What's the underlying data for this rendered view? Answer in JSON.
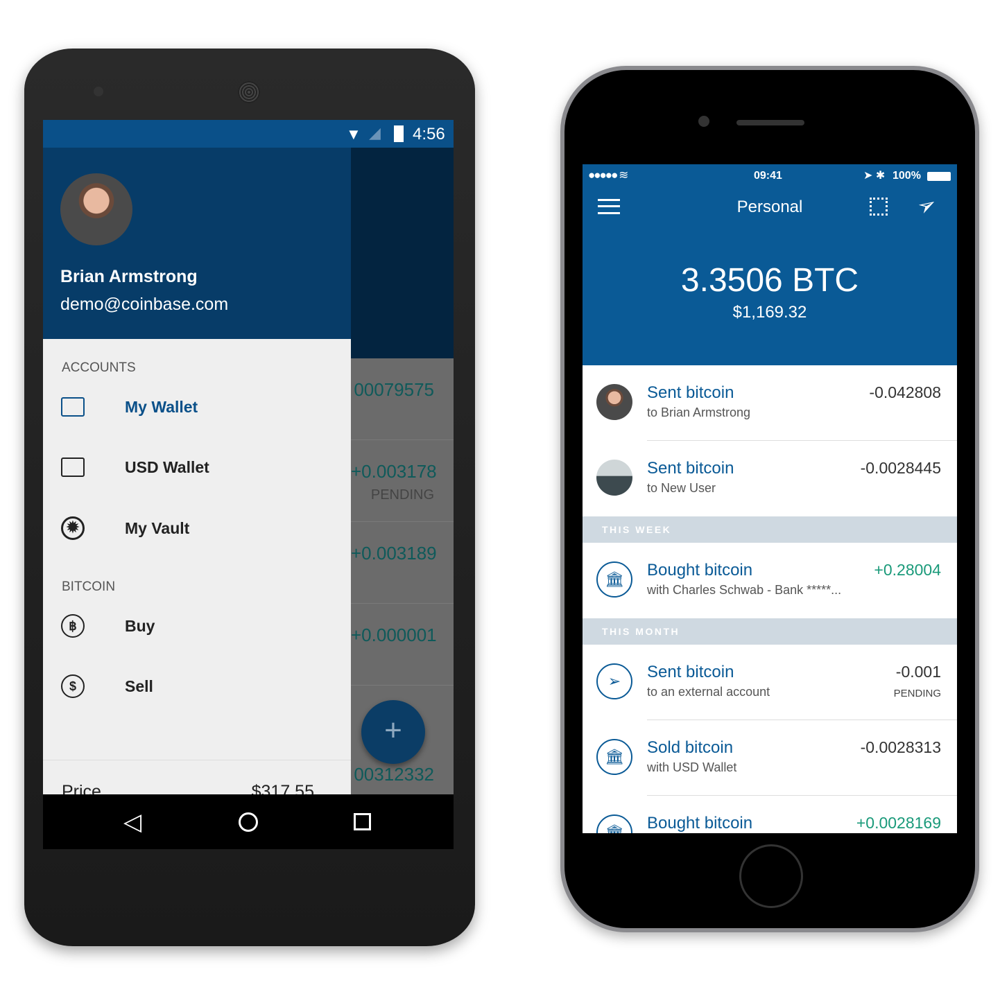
{
  "android": {
    "status_time": "4:56",
    "user": {
      "name": "Brian Armstrong",
      "email": "demo@coinbase.com"
    },
    "accounts_header": "ACCOUNTS",
    "accounts": [
      {
        "label": "My Wallet",
        "icon": "wallet-icon",
        "active": true
      },
      {
        "label": "USD Wallet",
        "icon": "wallet-icon",
        "active": false
      },
      {
        "label": "My Vault",
        "icon": "vault-icon",
        "active": false
      }
    ],
    "bitcoin_header": "BITCOIN",
    "bitcoin_items": [
      {
        "label": "Buy",
        "icon": "bitcoin-icon"
      },
      {
        "label": "Sell",
        "icon": "dollar-icon"
      }
    ],
    "price_label": "Price",
    "price_value": "$317.55",
    "background_rows": [
      {
        "amount": "00079575"
      },
      {
        "amount": "+0.003178",
        "status": "PENDING"
      },
      {
        "amount": "+0.003189"
      },
      {
        "amount": "+0.000001"
      },
      {
        "amount": "00312332"
      }
    ],
    "fab_label": "+"
  },
  "iphone": {
    "status": {
      "time": "09:41",
      "battery": "100%"
    },
    "title": "Personal",
    "balance_btc": "3.3506 BTC",
    "balance_usd": "$1,169.32",
    "transactions_top": [
      {
        "title": "Sent bitcoin",
        "subtitle": "to Brian Armstrong",
        "amount": "-0.042808",
        "icon": "avatar"
      },
      {
        "title": "Sent bitcoin",
        "subtitle": "to New User",
        "amount": "-0.0028445",
        "icon": "avatar"
      }
    ],
    "section_week": "THIS WEEK",
    "transactions_week": [
      {
        "title": "Bought bitcoin",
        "subtitle": "with Charles Schwab - Bank *****...",
        "amount": "+0.28004",
        "icon": "bank-in-icon"
      }
    ],
    "section_month": "THIS MONTH",
    "transactions_month": [
      {
        "title": "Sent bitcoin",
        "subtitle": "to an external account",
        "amount": "-0.001",
        "status": "PENDING",
        "icon": "send-icon"
      },
      {
        "title": "Sold bitcoin",
        "subtitle": "with USD Wallet",
        "amount": "-0.0028313",
        "icon": "bank-out-icon"
      },
      {
        "title": "Bought bitcoin",
        "subtitle": "",
        "amount": "+0.0028169",
        "icon": "bank-in-icon"
      }
    ]
  },
  "colors": {
    "android_header": "#073c68",
    "ios_header": "#0a5a96",
    "positive": "#1a9a7a"
  }
}
